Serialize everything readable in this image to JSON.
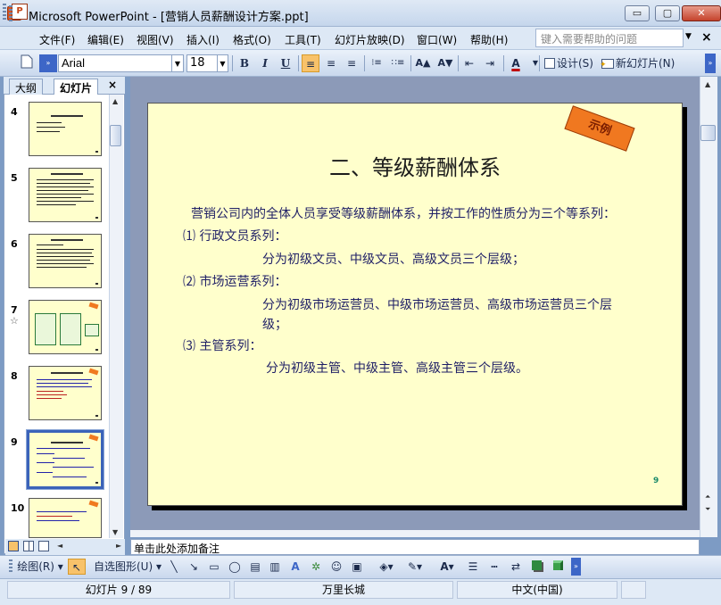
{
  "window": {
    "app_icon_letter": "P",
    "title": "Microsoft PowerPoint - [营销人员薪酬设计方案.ppt]",
    "min_glyph": "▭",
    "max_glyph": "▢",
    "close_glyph": "✕"
  },
  "menu": {
    "doc_icon_letter": "P",
    "items": [
      "文件(F)",
      "编辑(E)",
      "视图(V)",
      "插入(I)",
      "格式(O)",
      "工具(T)",
      "幻灯片放映(D)",
      "窗口(W)",
      "帮助(H)"
    ],
    "help_placeholder": "键入需要帮助的问题",
    "dropdown_glyph": "▼",
    "close_doc_glyph": "×"
  },
  "toolbar": {
    "font": "Arial",
    "size": "18",
    "bold": "B",
    "italic": "I",
    "underline": "U",
    "align_left": "≡",
    "align_center": "≡",
    "align_right": "≡",
    "numbered_list": "⁝≡",
    "bullet_list": "∷≡",
    "grow_font": "A▲",
    "shrink_font": "A▼",
    "decrease_indent": "⇤",
    "increase_indent": "⇥",
    "font_color": "A",
    "font_color_hex": "#c00000",
    "design_label": "设计(S)",
    "new_slide_label": "新幻灯片(N)",
    "overflow": "»"
  },
  "pane": {
    "tab_outline": "大纲",
    "tab_slides": "幻灯片",
    "close_glyph": "×",
    "thumbnail_numbers": [
      "4",
      "5",
      "6",
      "7",
      "8",
      "9",
      "10"
    ],
    "transition_star": "☆",
    "selected": "9"
  },
  "slide": {
    "tag": "示例",
    "title": "二、等级薪酬体系",
    "lines": [
      "营销公司内的全体人员享受等级薪酬体系，并按工作的性质分为三个等系列：",
      "⑴ 行政文员系列：",
      "分为初级文员、中级文员、高级文员三个层级；",
      "⑵ 市场运营系列：",
      "分为初级市场运营员、中级市场运营员、高级市场运营员三个层",
      "级；",
      "⑶ 主管系列：",
      "分为初级主管、中级主管、高级主管三个层级。"
    ],
    "page_number": "9"
  },
  "notes": {
    "placeholder": "单击此处添加备注"
  },
  "drawing_toolbar": {
    "draw_label": "绘图(R)",
    "autoshapes_label": "自选图形(U)",
    "overflow": "»"
  },
  "status": {
    "slide_position": "幻灯片 9 / 89",
    "design_template": "万里长城",
    "language": "中文(中国)"
  },
  "colors": {
    "slide_background": "#ffffcc",
    "tag_fill": "#f07820",
    "body_text": "#1f1f66",
    "selection_border": "#3b63b9"
  }
}
